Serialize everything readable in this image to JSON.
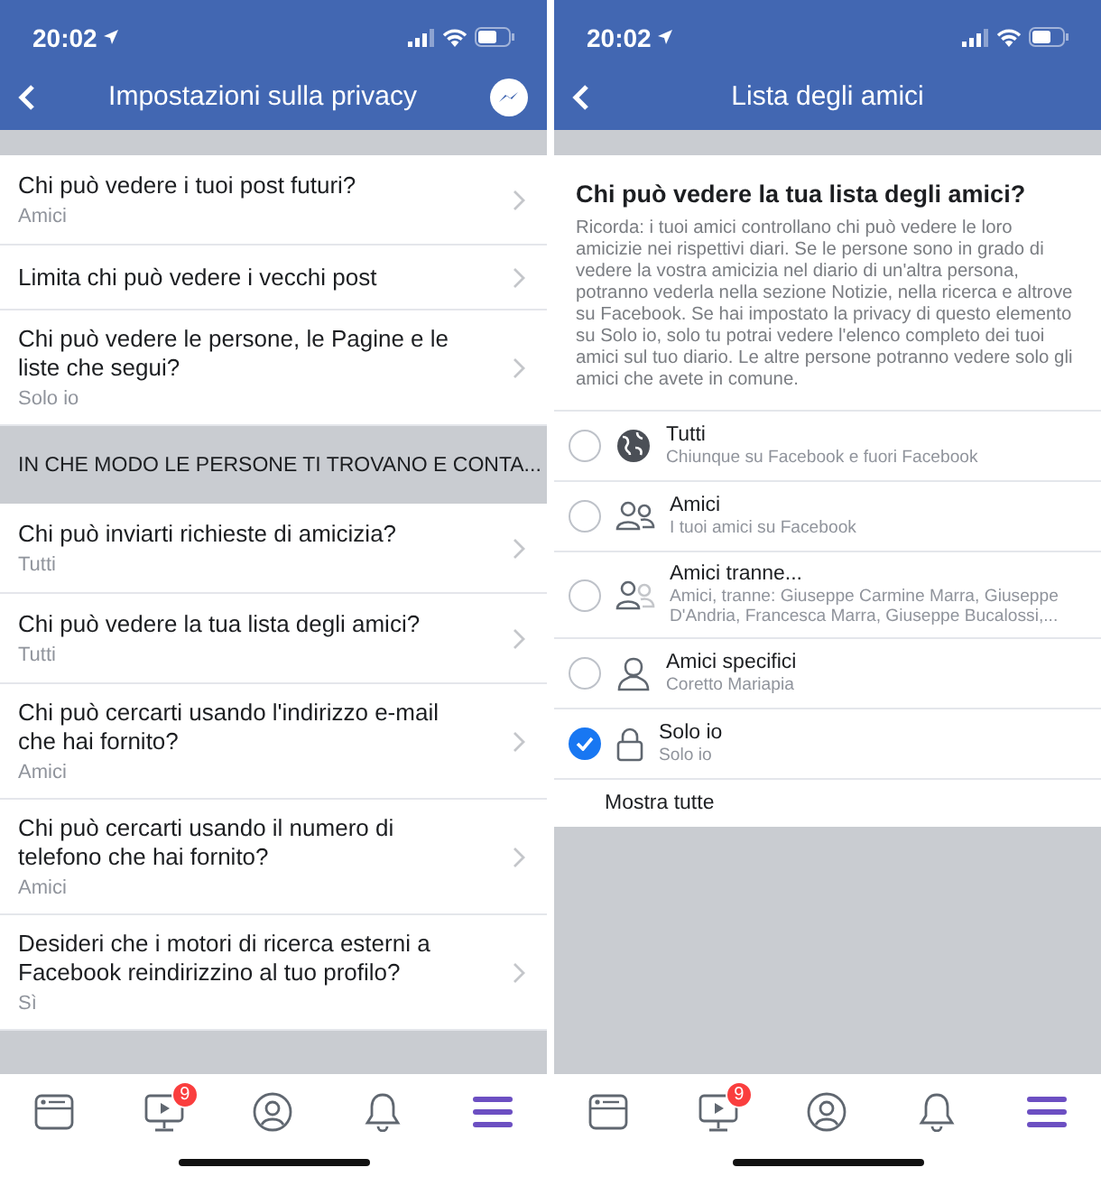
{
  "screens": [
    {
      "kind": "settings_list",
      "status_bar": {
        "time": "20:02"
      },
      "nav_bar": {
        "title": "Impostazioni sulla privacy"
      },
      "sections": [
        {
          "rows": [
            {
              "label": "Chi può vedere i tuoi post futuri?",
              "value": "Amici"
            },
            {
              "label": "Limita chi può vedere i vecchi post"
            },
            {
              "label": "Chi può vedere le persone, le Pagine e le liste che segui?",
              "value": "Solo io"
            }
          ]
        },
        {
          "title": "IN CHE MODO LE PERSONE TI TROVANO E CONTA...",
          "rows": [
            {
              "label": "Chi può inviarti richieste di amicizia?",
              "value": "Tutti"
            },
            {
              "label": "Chi può vedere la tua lista degli amici?",
              "value": "Tutti"
            },
            {
              "label": "Chi può cercarti usando l'indirizzo e-mail che hai fornito?",
              "value": "Amici"
            },
            {
              "label": "Chi può cercarti usando il numero di telefono che hai fornito?",
              "value": "Amici"
            },
            {
              "label": "Desideri che i motori di ricerca esterni a Facebook reindirizzino al tuo profilo?",
              "value": "Sì"
            }
          ]
        }
      ],
      "tab_bar": [
        {
          "selected": false
        },
        {
          "selected": false,
          "badge": "9"
        },
        {
          "selected": false
        },
        {
          "selected": false
        },
        {
          "selected": true
        }
      ]
    },
    {
      "kind": "option_picker",
      "status_bar": {
        "time": "20:02"
      },
      "nav_bar": {
        "title": "Lista degli amici"
      },
      "question": "Chi può vedere la tua lista degli amici?",
      "description": "Ricorda: i tuoi amici controllano chi può vedere le loro amicizie nei rispettivi diari. Se le persone sono in grado di vedere la vostra amicizia nel diario di un'altra persona, potranno vederla nella sezione Notizie, nella ricerca e altrove su Facebook. Se hai impostato la privacy di questo elemento su Solo io, solo tu potrai vedere l'elenco completo dei tuoi amici sul tuo diario. Le altre persone potranno vedere solo gli amici che avete in comune.",
      "options": [
        {
          "title": "Tutti",
          "subtitle": "Chiunque su Facebook e fuori Facebook",
          "selected": false
        },
        {
          "title": "Amici",
          "subtitle": "I tuoi amici su Facebook",
          "selected": false
        },
        {
          "title": "Amici tranne...",
          "subtitle": "Amici, tranne: Giuseppe Carmine Marra, Giuseppe D'Andria, Francesca Marra, Giuseppe Bucalossi,...",
          "selected": false
        },
        {
          "title": "Amici specifici",
          "subtitle": "Coretto Mariapia",
          "selected": false
        },
        {
          "title": "Solo io",
          "subtitle": "Solo io",
          "selected": true
        }
      ],
      "show_all": "Mostra tutte",
      "tab_bar": [
        {
          "selected": false
        },
        {
          "selected": false,
          "badge": "9"
        },
        {
          "selected": false
        },
        {
          "selected": false
        },
        {
          "selected": true
        }
      ]
    }
  ]
}
